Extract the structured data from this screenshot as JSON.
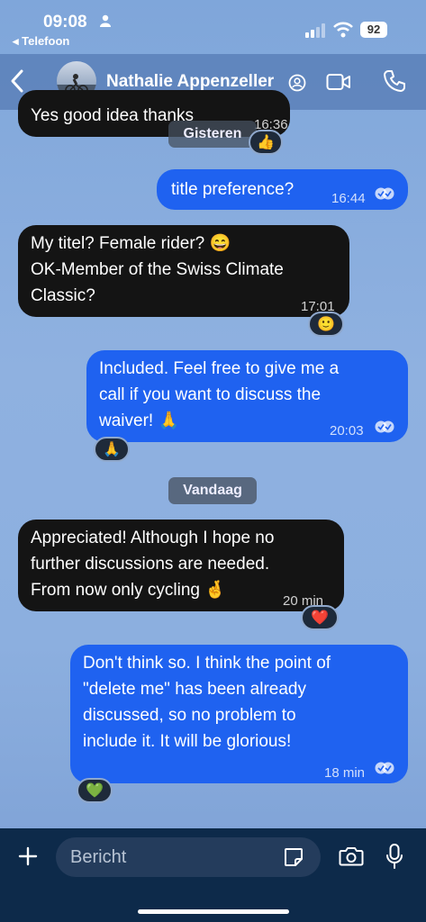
{
  "status": {
    "time": "09:08",
    "back_app": "◂ Telefoon",
    "battery": "92"
  },
  "header": {
    "contact_name": "Nathalie Appenzeller"
  },
  "dates": {
    "yesterday": "Gisteren",
    "today": "Vandaag"
  },
  "messages": [
    {
      "dir": "in",
      "text": "Yes good idea thanks",
      "time": "16:36",
      "reaction": "👍"
    },
    {
      "dir": "out",
      "text": "title preference?",
      "time": "16:44"
    },
    {
      "dir": "in",
      "lines": [
        "My titel? Female rider? 😄",
        "OK-Member of the Swiss Climate",
        "Classic?"
      ],
      "time": "17:01",
      "reaction": "🙂"
    },
    {
      "dir": "out",
      "lines": [
        "Included.  Feel free to give me a",
        "call if you want to discuss the",
        "waiver! 🙏"
      ],
      "time": "20:03",
      "reaction": "🙏"
    },
    {
      "dir": "in",
      "lines": [
        "Appreciated! Although I hope no",
        "further discussions are needed.",
        "From now only cycling 🤞"
      ],
      "time": "20 min",
      "reaction": "❤️"
    },
    {
      "dir": "out",
      "lines": [
        "Don't think so.  I think the point of",
        "\"delete me\" has been already",
        "discussed, so no problem to",
        "include it.   It will be glorious!"
      ],
      "time": "18 min",
      "reaction": "💚"
    }
  ],
  "input": {
    "placeholder": "Bericht"
  },
  "colors": {
    "incoming": "#141414",
    "outgoing": "#1f62f0",
    "input_bar": "#0d2a4a"
  }
}
